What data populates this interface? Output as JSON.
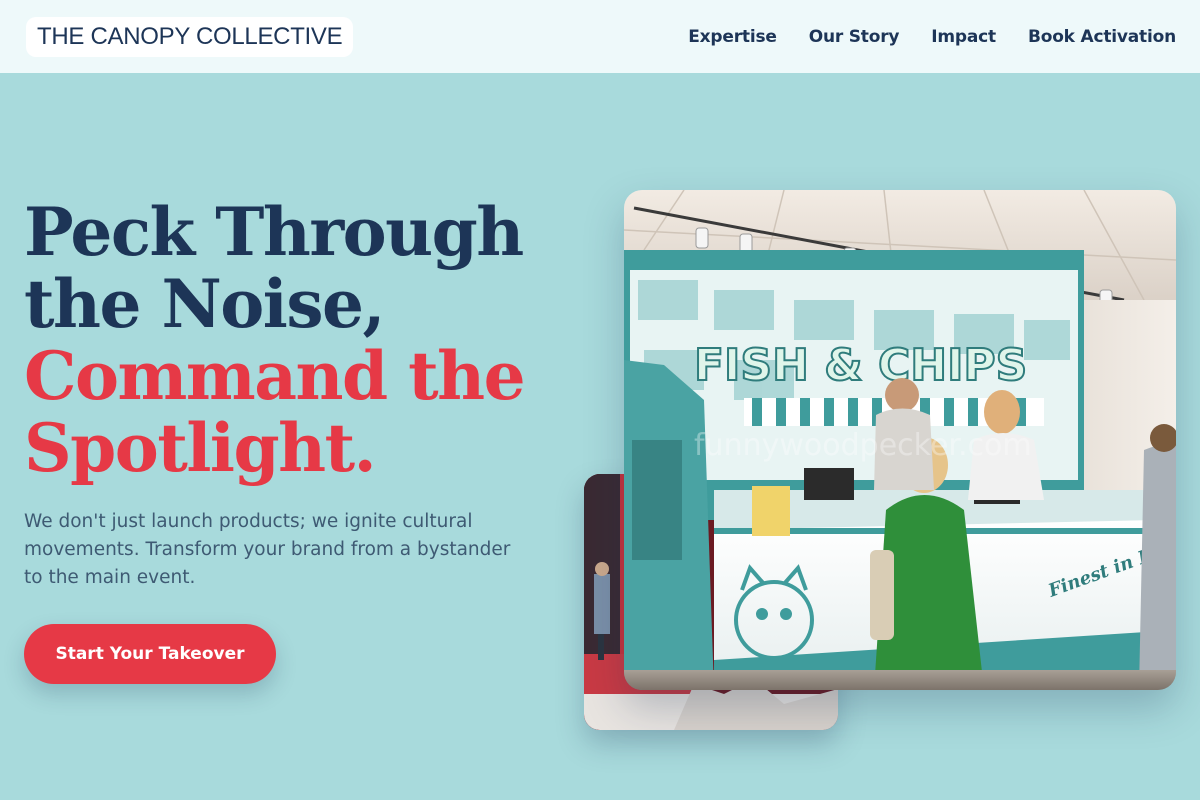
{
  "header": {
    "logo": "THE CANOPY COLLECTIVE",
    "nav": [
      "Expertise",
      "Our Story",
      "Impact",
      "Book Activation"
    ]
  },
  "hero": {
    "title_line1": "Peck Through",
    "title_line2": "the Noise,",
    "title_line3": "Command the",
    "title_line4": "Spotlight.",
    "subtitle": "We don't just launch products; we ignite cultural movements. Transform your brand from a bystander to the main event.",
    "cta": "Start Your Takeover"
  },
  "photo": {
    "sign_text": "FISH & CHIPS",
    "van_script": "Finest in London!",
    "watermark": "funnywoodpecker.com"
  },
  "colors": {
    "background": "#a8dadc",
    "header_bg": "#eef9fa",
    "navy": "#1d3557",
    "accent_red": "#e63946",
    "van_teal": "#3f9c9c"
  }
}
